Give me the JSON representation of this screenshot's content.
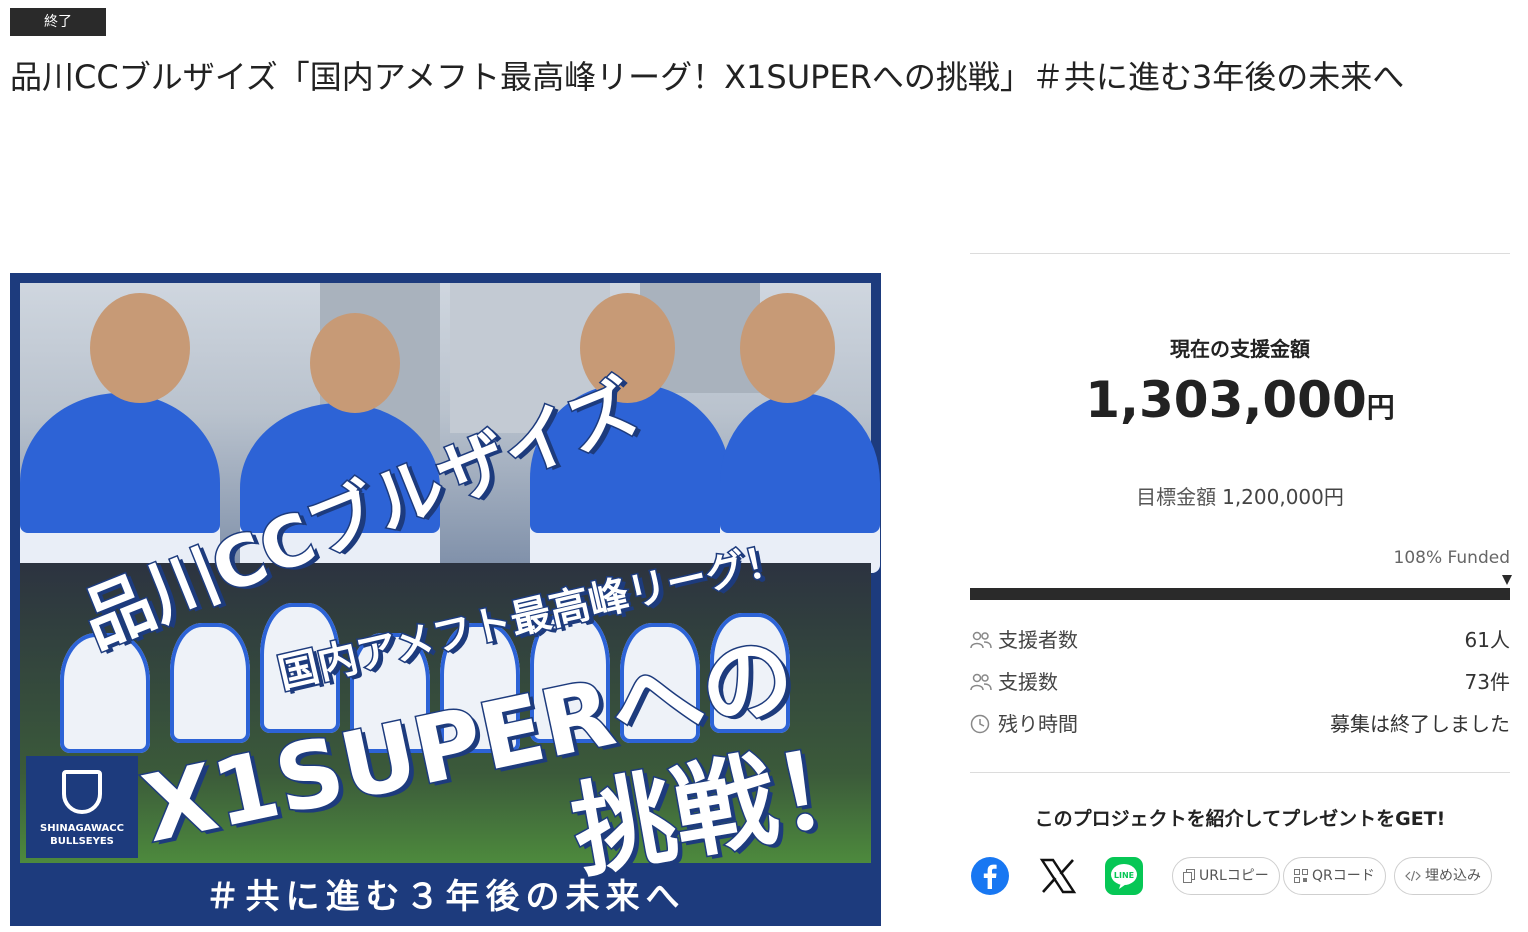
{
  "status_badge": "終了",
  "page_title": "品川CCブルザイズ「国内アメフト最高峰リーグ！X1SUPERへの挑戦」＃共に進む3年後の未来へ",
  "hero": {
    "line1": "品川CCブルザイズ",
    "line2": "国内アメフト最高峰リーグ！",
    "line3": "X1SUPERへの",
    "line4": "挑戦！",
    "hashtag": "＃共に進む３年後の未来へ",
    "logo_line1": "SHINAGAWACC",
    "logo_line2": "BULLSEYES"
  },
  "funding": {
    "raised_label": "現在の支援金額",
    "raised_amount": "1,303,000",
    "currency": "円",
    "goal_label": "目標金額",
    "goal_value": "1,200,000円",
    "funded_text": "108% Funded",
    "progress_fraction": 1.0
  },
  "stats": [
    {
      "label": "支援者数",
      "value": "61人",
      "icon": "people-icon"
    },
    {
      "label": "支援数",
      "value": "73件",
      "icon": "people-icon"
    },
    {
      "label": "残り時間",
      "value": "募集は終了しました",
      "icon": "clock-icon"
    }
  ],
  "share": {
    "title": "このプロジェクトを紹介してプレゼントをGET!",
    "url_copy": "URLコピー",
    "qr_code": "QRコード",
    "embed": "埋め込み"
  },
  "colors": {
    "hero_navy": "#1d3b7d",
    "facebook": "#1877f2",
    "line": "#06c755",
    "progress": "#2a2a2a"
  }
}
